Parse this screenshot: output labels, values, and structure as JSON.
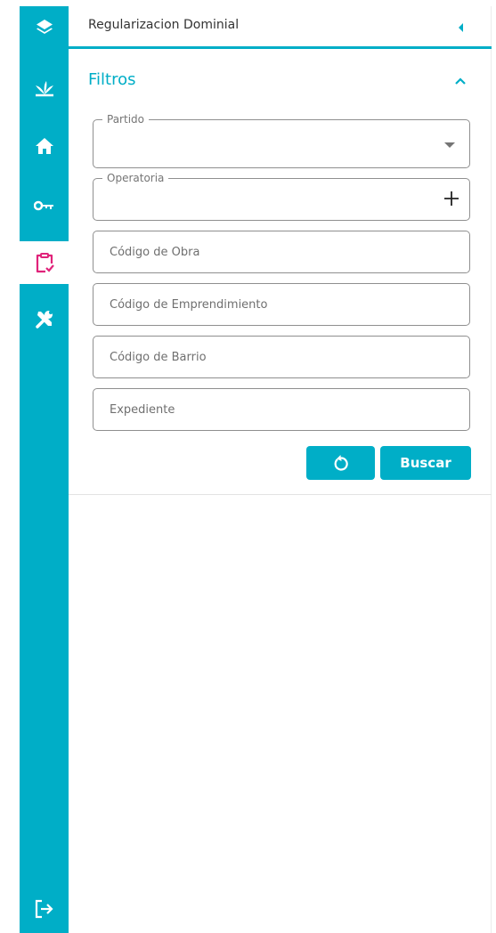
{
  "colors": {
    "accent": "#00aec7",
    "active_icon": "#e0237a",
    "rail_bg": "#00aec7"
  },
  "rail": {
    "items": [
      {
        "icon": "layers-icon",
        "active": false
      },
      {
        "icon": "plant-icon",
        "active": false
      },
      {
        "icon": "home-icon",
        "active": false
      },
      {
        "icon": "key-icon",
        "active": false
      },
      {
        "icon": "clipboard-check-icon",
        "active": true
      },
      {
        "icon": "tools-icon",
        "active": false
      }
    ],
    "bottom_icon": "logout-icon"
  },
  "panel": {
    "title": "Regularizacion Dominial",
    "collapse_icon": "caret-left-icon"
  },
  "filters": {
    "title": "Filtros",
    "toggle_icon": "chevron-up-icon",
    "partido": {
      "label": "Partido",
      "value": "",
      "icon": "dropdown-caret-icon"
    },
    "operatoria": {
      "label": "Operatoria",
      "value": "",
      "icon": "plus-icon"
    },
    "inputs": [
      {
        "placeholder": "Código de Obra",
        "value": ""
      },
      {
        "placeholder": "Código de Emprendimiento",
        "value": ""
      },
      {
        "placeholder": "Código de Barrio",
        "value": ""
      },
      {
        "placeholder": "Expediente",
        "value": ""
      }
    ],
    "reset_icon": "reset-icon",
    "search_label": "Buscar"
  }
}
